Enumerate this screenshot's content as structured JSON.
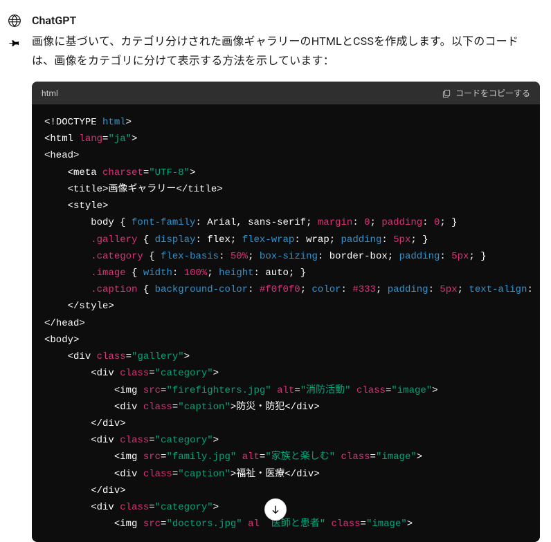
{
  "sender": "ChatGPT",
  "description": "画像に基づいて、カテゴリ分けされた画像ギャラリーのHTMLとCSSを作成します。以下のコードは、画像をカテゴリに分けて表示する方法を示しています：",
  "code_lang": "html",
  "copy_label": "コードをコピーする",
  "code_lines": [
    [
      {
        "t": "<!",
        "c": "c-punct"
      },
      {
        "t": "DOCTYPE ",
        "c": "c-punct"
      },
      {
        "t": "html",
        "c": "c-tag"
      },
      {
        "t": ">",
        "c": "c-punct"
      }
    ],
    [
      {
        "t": "<",
        "c": "c-punct"
      },
      {
        "t": "html ",
        "c": "c-text"
      },
      {
        "t": "lang",
        "c": "c-attr"
      },
      {
        "t": "=",
        "c": "c-punct"
      },
      {
        "t": "\"ja\"",
        "c": "c-str"
      },
      {
        "t": ">",
        "c": "c-punct"
      }
    ],
    [
      {
        "t": "<",
        "c": "c-punct"
      },
      {
        "t": "head",
        "c": "c-text"
      },
      {
        "t": ">",
        "c": "c-punct"
      }
    ],
    [
      {
        "t": "    <",
        "c": "c-punct"
      },
      {
        "t": "meta ",
        "c": "c-text"
      },
      {
        "t": "charset",
        "c": "c-attr"
      },
      {
        "t": "=",
        "c": "c-punct"
      },
      {
        "t": "\"UTF-8\"",
        "c": "c-str"
      },
      {
        "t": ">",
        "c": "c-punct"
      }
    ],
    [
      {
        "t": "    <",
        "c": "c-punct"
      },
      {
        "t": "title",
        "c": "c-text"
      },
      {
        "t": ">",
        "c": "c-punct"
      },
      {
        "t": "画像ギャラリー",
        "c": "c-text"
      },
      {
        "t": "</",
        "c": "c-punct"
      },
      {
        "t": "title",
        "c": "c-text"
      },
      {
        "t": ">",
        "c": "c-punct"
      }
    ],
    [
      {
        "t": "    <",
        "c": "c-punct"
      },
      {
        "t": "style",
        "c": "c-text"
      },
      {
        "t": ">",
        "c": "c-punct"
      }
    ],
    [
      {
        "t": "        body { ",
        "c": "c-text"
      },
      {
        "t": "font-family",
        "c": "c-css-prop"
      },
      {
        "t": ": Arial, sans-serif; ",
        "c": "c-text"
      },
      {
        "t": "margin",
        "c": "c-attr"
      },
      {
        "t": ": ",
        "c": "c-text"
      },
      {
        "t": "0",
        "c": "c-num"
      },
      {
        "t": "; ",
        "c": "c-text"
      },
      {
        "t": "padding",
        "c": "c-attr"
      },
      {
        "t": ": ",
        "c": "c-text"
      },
      {
        "t": "0",
        "c": "c-num"
      },
      {
        "t": "; }",
        "c": "c-text"
      }
    ],
    [
      {
        "t": "        ",
        "c": "c-text"
      },
      {
        "t": ".gallery",
        "c": "c-css-sel"
      },
      {
        "t": " { ",
        "c": "c-text"
      },
      {
        "t": "display",
        "c": "c-css-prop"
      },
      {
        "t": ": flex; ",
        "c": "c-text"
      },
      {
        "t": "flex-wrap",
        "c": "c-css-prop"
      },
      {
        "t": ": wrap; ",
        "c": "c-text"
      },
      {
        "t": "padding",
        "c": "c-css-prop"
      },
      {
        "t": ": ",
        "c": "c-text"
      },
      {
        "t": "5px",
        "c": "c-num"
      },
      {
        "t": "; }",
        "c": "c-text"
      }
    ],
    [
      {
        "t": "        ",
        "c": "c-text"
      },
      {
        "t": ".category",
        "c": "c-css-sel"
      },
      {
        "t": " { ",
        "c": "c-text"
      },
      {
        "t": "flex-basis",
        "c": "c-css-prop"
      },
      {
        "t": ": ",
        "c": "c-text"
      },
      {
        "t": "50%",
        "c": "c-num"
      },
      {
        "t": "; ",
        "c": "c-text"
      },
      {
        "t": "box-sizing",
        "c": "c-css-prop"
      },
      {
        "t": ": border-box; ",
        "c": "c-text"
      },
      {
        "t": "padding",
        "c": "c-css-prop"
      },
      {
        "t": ": ",
        "c": "c-text"
      },
      {
        "t": "5px",
        "c": "c-num"
      },
      {
        "t": "; }",
        "c": "c-text"
      }
    ],
    [
      {
        "t": "        ",
        "c": "c-text"
      },
      {
        "t": ".image",
        "c": "c-css-sel"
      },
      {
        "t": " { ",
        "c": "c-text"
      },
      {
        "t": "width",
        "c": "c-css-prop"
      },
      {
        "t": ": ",
        "c": "c-text"
      },
      {
        "t": "100%",
        "c": "c-num"
      },
      {
        "t": "; ",
        "c": "c-text"
      },
      {
        "t": "height",
        "c": "c-css-prop"
      },
      {
        "t": ": auto; }",
        "c": "c-text"
      }
    ],
    [
      {
        "t": "        ",
        "c": "c-text"
      },
      {
        "t": ".caption",
        "c": "c-css-sel"
      },
      {
        "t": " { ",
        "c": "c-text"
      },
      {
        "t": "background-color",
        "c": "c-css-prop"
      },
      {
        "t": ": ",
        "c": "c-text"
      },
      {
        "t": "#f0f0f0",
        "c": "c-hex"
      },
      {
        "t": "; ",
        "c": "c-text"
      },
      {
        "t": "color",
        "c": "c-css-prop"
      },
      {
        "t": ": ",
        "c": "c-text"
      },
      {
        "t": "#333",
        "c": "c-hex"
      },
      {
        "t": "; ",
        "c": "c-text"
      },
      {
        "t": "padding",
        "c": "c-css-prop"
      },
      {
        "t": ": ",
        "c": "c-text"
      },
      {
        "t": "5px",
        "c": "c-num"
      },
      {
        "t": "; ",
        "c": "c-text"
      },
      {
        "t": "text-align",
        "c": "c-css-prop"
      },
      {
        "t": ":",
        "c": "c-text"
      }
    ],
    [
      {
        "t": "    </",
        "c": "c-punct"
      },
      {
        "t": "style",
        "c": "c-text"
      },
      {
        "t": ">",
        "c": "c-punct"
      }
    ],
    [
      {
        "t": "</",
        "c": "c-punct"
      },
      {
        "t": "head",
        "c": "c-text"
      },
      {
        "t": ">",
        "c": "c-punct"
      }
    ],
    [
      {
        "t": "<",
        "c": "c-punct"
      },
      {
        "t": "body",
        "c": "c-text"
      },
      {
        "t": ">",
        "c": "c-punct"
      }
    ],
    [
      {
        "t": "    <",
        "c": "c-punct"
      },
      {
        "t": "div ",
        "c": "c-text"
      },
      {
        "t": "class",
        "c": "c-attr"
      },
      {
        "t": "=",
        "c": "c-punct"
      },
      {
        "t": "\"gallery\"",
        "c": "c-str"
      },
      {
        "t": ">",
        "c": "c-punct"
      }
    ],
    [
      {
        "t": "        <",
        "c": "c-punct"
      },
      {
        "t": "div ",
        "c": "c-text"
      },
      {
        "t": "class",
        "c": "c-attr"
      },
      {
        "t": "=",
        "c": "c-punct"
      },
      {
        "t": "\"category\"",
        "c": "c-str"
      },
      {
        "t": ">",
        "c": "c-punct"
      }
    ],
    [
      {
        "t": "            <",
        "c": "c-punct"
      },
      {
        "t": "img ",
        "c": "c-text"
      },
      {
        "t": "src",
        "c": "c-attr"
      },
      {
        "t": "=",
        "c": "c-punct"
      },
      {
        "t": "\"firefighters.jpg\"",
        "c": "c-str"
      },
      {
        "t": " ",
        "c": "c-text"
      },
      {
        "t": "alt",
        "c": "c-attr"
      },
      {
        "t": "=",
        "c": "c-punct"
      },
      {
        "t": "\"消防活動\"",
        "c": "c-str"
      },
      {
        "t": " ",
        "c": "c-text"
      },
      {
        "t": "class",
        "c": "c-attr"
      },
      {
        "t": "=",
        "c": "c-punct"
      },
      {
        "t": "\"image\"",
        "c": "c-str"
      },
      {
        "t": ">",
        "c": "c-punct"
      }
    ],
    [
      {
        "t": "            <",
        "c": "c-punct"
      },
      {
        "t": "div ",
        "c": "c-text"
      },
      {
        "t": "class",
        "c": "c-attr"
      },
      {
        "t": "=",
        "c": "c-punct"
      },
      {
        "t": "\"caption\"",
        "c": "c-str"
      },
      {
        "t": ">",
        "c": "c-punct"
      },
      {
        "t": "防災・防犯",
        "c": "c-text"
      },
      {
        "t": "</",
        "c": "c-punct"
      },
      {
        "t": "div",
        "c": "c-text"
      },
      {
        "t": ">",
        "c": "c-punct"
      }
    ],
    [
      {
        "t": "        </",
        "c": "c-punct"
      },
      {
        "t": "div",
        "c": "c-text"
      },
      {
        "t": ">",
        "c": "c-punct"
      }
    ],
    [
      {
        "t": "        <",
        "c": "c-punct"
      },
      {
        "t": "div ",
        "c": "c-text"
      },
      {
        "t": "class",
        "c": "c-attr"
      },
      {
        "t": "=",
        "c": "c-punct"
      },
      {
        "t": "\"category\"",
        "c": "c-str"
      },
      {
        "t": ">",
        "c": "c-punct"
      }
    ],
    [
      {
        "t": "            <",
        "c": "c-punct"
      },
      {
        "t": "img ",
        "c": "c-text"
      },
      {
        "t": "src",
        "c": "c-attr"
      },
      {
        "t": "=",
        "c": "c-punct"
      },
      {
        "t": "\"family.jpg\"",
        "c": "c-str"
      },
      {
        "t": " ",
        "c": "c-text"
      },
      {
        "t": "alt",
        "c": "c-attr"
      },
      {
        "t": "=",
        "c": "c-punct"
      },
      {
        "t": "\"家族と楽しむ\"",
        "c": "c-str"
      },
      {
        "t": " ",
        "c": "c-text"
      },
      {
        "t": "class",
        "c": "c-attr"
      },
      {
        "t": "=",
        "c": "c-punct"
      },
      {
        "t": "\"image\"",
        "c": "c-str"
      },
      {
        "t": ">",
        "c": "c-punct"
      }
    ],
    [
      {
        "t": "            <",
        "c": "c-punct"
      },
      {
        "t": "div ",
        "c": "c-text"
      },
      {
        "t": "class",
        "c": "c-attr"
      },
      {
        "t": "=",
        "c": "c-punct"
      },
      {
        "t": "\"caption\"",
        "c": "c-str"
      },
      {
        "t": ">",
        "c": "c-punct"
      },
      {
        "t": "福祉・医療",
        "c": "c-text"
      },
      {
        "t": "</",
        "c": "c-punct"
      },
      {
        "t": "div",
        "c": "c-text"
      },
      {
        "t": ">",
        "c": "c-punct"
      }
    ],
    [
      {
        "t": "        </",
        "c": "c-punct"
      },
      {
        "t": "div",
        "c": "c-text"
      },
      {
        "t": ">",
        "c": "c-punct"
      }
    ],
    [
      {
        "t": "        <",
        "c": "c-punct"
      },
      {
        "t": "div ",
        "c": "c-text"
      },
      {
        "t": "class",
        "c": "c-attr"
      },
      {
        "t": "=",
        "c": "c-punct"
      },
      {
        "t": "\"category\"",
        "c": "c-str"
      },
      {
        "t": ">",
        "c": "c-punct"
      }
    ],
    [
      {
        "t": "            <",
        "c": "c-punct"
      },
      {
        "t": "img ",
        "c": "c-text"
      },
      {
        "t": "src",
        "c": "c-attr"
      },
      {
        "t": "=",
        "c": "c-punct"
      },
      {
        "t": "\"doctors.jpg\"",
        "c": "c-str"
      },
      {
        "t": " ",
        "c": "c-text"
      },
      {
        "t": "al",
        "c": "c-attr"
      },
      {
        "t": "  ",
        "c": "c-text"
      },
      {
        "t": "医師と患者\"",
        "c": "c-str"
      },
      {
        "t": " ",
        "c": "c-text"
      },
      {
        "t": "class",
        "c": "c-attr"
      },
      {
        "t": "=",
        "c": "c-punct"
      },
      {
        "t": "\"image\"",
        "c": "c-str"
      },
      {
        "t": ">",
        "c": "c-punct"
      }
    ]
  ]
}
